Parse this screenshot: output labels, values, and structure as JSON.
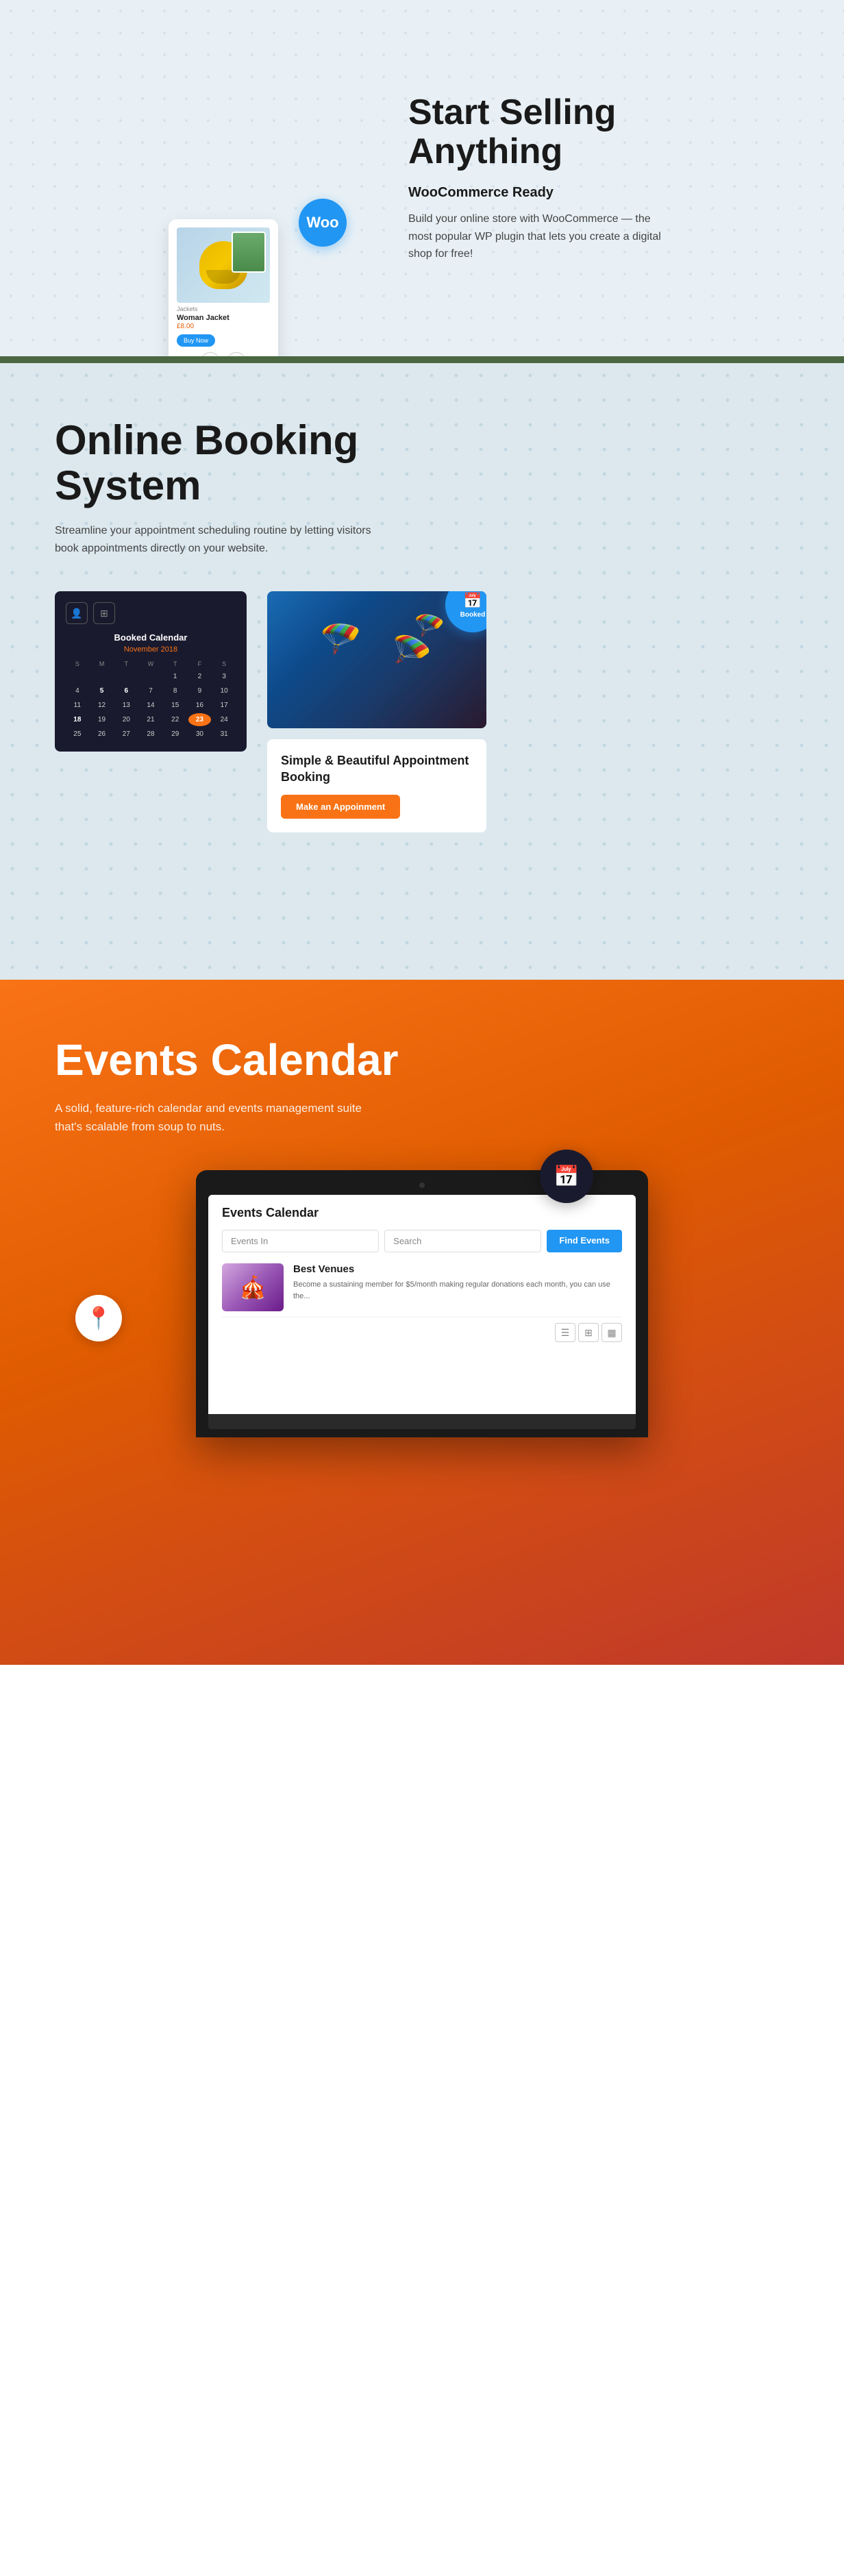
{
  "woo": {
    "title_line1": "Start Selling",
    "title_line2": "Anything",
    "subtitle": "WooCommerce Ready",
    "description": "Build your online store with WooCommerce —  the most popular WP plugin that lets you create a digital shop for free!",
    "badge_text": "Woo",
    "product_label": "Jackets",
    "product_name": "Woman Jacket",
    "product_price": "£8.00",
    "buy_btn": "Buy Now"
  },
  "booking": {
    "title_line1": "Online Booking",
    "title_line2": "System",
    "description": "Streamline your appointment scheduling routine by letting visitors book appointments directly on your website.",
    "calendar_title": "Booked Calendar",
    "calendar_month": "November 2018",
    "day_headers": [
      "S",
      "M",
      "T",
      "W",
      "T",
      "F",
      "S"
    ],
    "badge_label": "Booked",
    "info_title": "Simple & Beautiful Appointment Booking",
    "appt_btn": "Make an Appoinment"
  },
  "events": {
    "title": "Events Calendar",
    "description": "A solid, feature-rich calendar and events management suite that's scalable from soup to nuts.",
    "app_title": "Events Calendar",
    "search_label": "Events In",
    "search_placeholder": "Search",
    "find_btn": "Find Events",
    "venue_name": "Best Venues",
    "venue_desc": "Become a sustaining member for $5/month making regular donations each month, you can use the..."
  }
}
